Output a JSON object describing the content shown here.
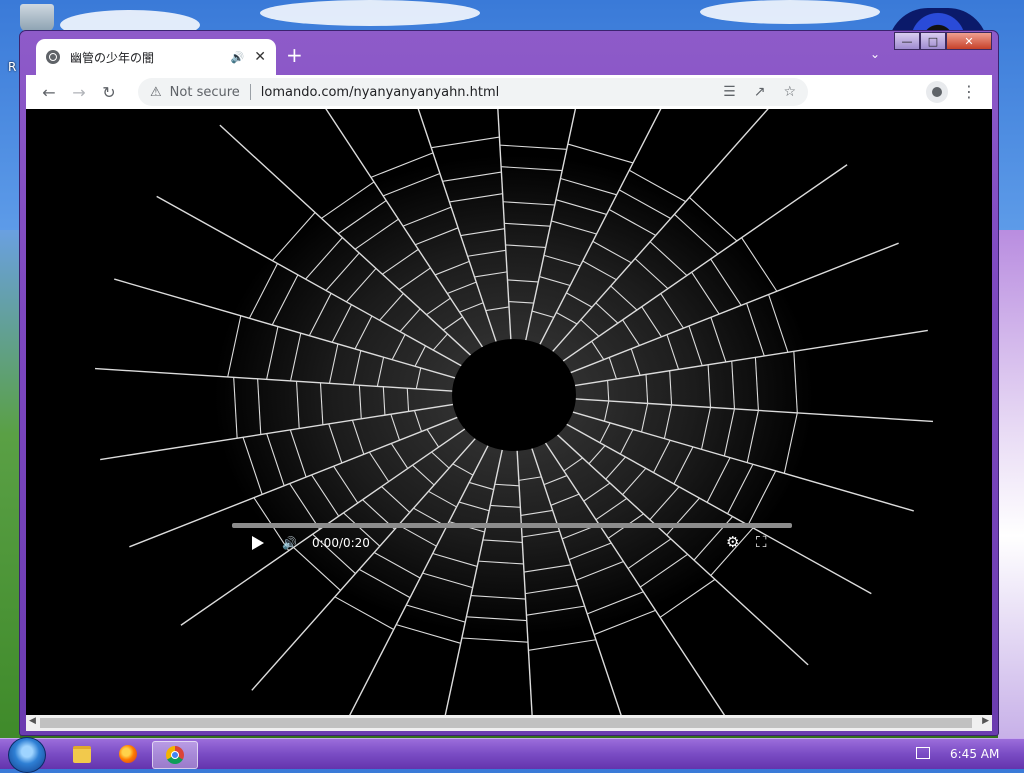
{
  "browser": {
    "tab_title": "幽管の少年の闇",
    "tab_audio_icon": "speaker-icon",
    "security_label": "Not secure",
    "url": "lomando.com/nyanyanyanyahn.html",
    "tab_list_icon": "chevron-down-icon",
    "toolbar_icons": [
      "back-arrow-icon",
      "forward-arrow-icon",
      "reload-icon",
      "translate-icon",
      "share-icon",
      "star-icon",
      "profile-icon",
      "kebab-menu-icon"
    ]
  },
  "window_controls": [
    "minimize",
    "maximize",
    "close"
  ],
  "video": {
    "time": "0:00/0:20",
    "progress_fraction": 0,
    "icons": [
      "play-icon",
      "volume-icon",
      "settings-gear-icon",
      "fullscreen-icon"
    ]
  },
  "taskbar": {
    "items": [
      "file-explorer",
      "firefox",
      "chrome"
    ],
    "active_item": "chrome",
    "clock": "6:45 AM"
  },
  "desktop": {
    "left_edge_text": "R"
  },
  "colors": {
    "window_frame": "#7d48c0",
    "taskbar": "#7a4cc4",
    "video_bg": "#000000"
  }
}
